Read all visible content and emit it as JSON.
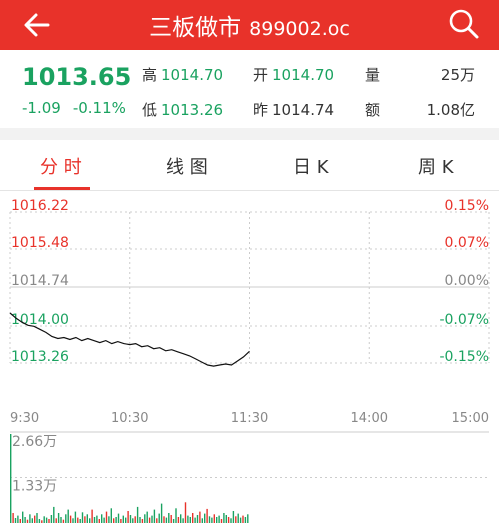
{
  "header": {
    "title": "三板做市",
    "code": "899002.oc",
    "back_icon": "arrow-left-icon",
    "search_icon": "search-icon",
    "bar_color": "#e8322a"
  },
  "quote": {
    "price": "1013.65",
    "change": "-1.09",
    "change_pct": "-0.11%",
    "high_label": "高",
    "high": "1014.70",
    "open_label": "开",
    "open": "1014.70",
    "volume_label": "量",
    "volume": "25万",
    "low_label": "低",
    "low": "1013.26",
    "prev_close_label": "昨",
    "prev_close": "1014.74",
    "amount_label": "额",
    "amount": "1.08亿"
  },
  "tabs": [
    {
      "label": "分 时",
      "active": true
    },
    {
      "label": "线 图",
      "active": false
    },
    {
      "label": "日 K",
      "active": false
    },
    {
      "label": "周 K",
      "active": false
    }
  ],
  "chart_data": {
    "type": "line",
    "price_axis_labels": [
      "1016.22",
      "1015.48",
      "1014.74",
      "1014.00",
      "1013.26"
    ],
    "pct_axis_labels": [
      "0.15%",
      "0.07%",
      "0.00%",
      "-0.07%",
      "-0.15%"
    ],
    "ylim": [
      1013.26,
      1016.22
    ],
    "prev_close": 1014.74,
    "time_labels": [
      "9:30",
      "10:30",
      "11:30",
      "14:00",
      "15:00"
    ],
    "series": [
      {
        "x": [
          "9:30",
          "9:33",
          "9:36",
          "9:39",
          "9:42",
          "9:45",
          "9:48",
          "9:51",
          "9:54",
          "9:57",
          "10:00",
          "10:03",
          "10:06",
          "10:09",
          "10:12",
          "10:15",
          "10:18",
          "10:21",
          "10:24",
          "10:27",
          "10:30",
          "10:33",
          "10:36",
          "10:39",
          "10:42",
          "10:45",
          "10:48",
          "10:51",
          "10:54",
          "10:57",
          "11:00",
          "11:03",
          "11:06",
          "11:09",
          "11:12",
          "11:15",
          "11:18",
          "11:21",
          "11:24",
          "11:27",
          "11:30"
        ],
        "values": [
          1014.24,
          1014.14,
          1014.06,
          1014.0,
          1013.98,
          1013.92,
          1013.86,
          1013.78,
          1013.74,
          1013.76,
          1013.72,
          1013.76,
          1013.7,
          1013.74,
          1013.7,
          1013.66,
          1013.7,
          1013.64,
          1013.68,
          1013.64,
          1013.62,
          1013.64,
          1013.58,
          1013.6,
          1013.54,
          1013.56,
          1013.5,
          1013.52,
          1013.48,
          1013.44,
          1013.4,
          1013.34,
          1013.28,
          1013.22,
          1013.2,
          1013.22,
          1013.24,
          1013.22,
          1013.3,
          1013.38,
          1013.49
        ]
      }
    ],
    "volume_axis_labels": [
      "2.66万",
      "1.33万"
    ],
    "volume_ylim": [
      0,
      2.66
    ],
    "volume_unit": "万",
    "volume": [
      2.66,
      0.3,
      0.15,
      0.22,
      0.12,
      0.34,
      0.18,
      0.1,
      0.26,
      0.14,
      0.22,
      0.3,
      0.12,
      0.08,
      0.2,
      0.16,
      0.12,
      0.24,
      0.48,
      0.14,
      0.3,
      0.18,
      0.1,
      0.26,
      0.4,
      0.22,
      0.14,
      0.34,
      0.16,
      0.12,
      0.32,
      0.2,
      0.26,
      0.14,
      0.4,
      0.18,
      0.22,
      0.12,
      0.26,
      0.16,
      0.34,
      0.2,
      0.44,
      0.14,
      0.18,
      0.28,
      0.12,
      0.22,
      0.16,
      0.36,
      0.24,
      0.14,
      0.2,
      0.48,
      0.18,
      0.12,
      0.26,
      0.34,
      0.16,
      0.22,
      0.4,
      0.14,
      0.28,
      0.58,
      0.2,
      0.16,
      0.3,
      0.24,
      0.12,
      0.44,
      0.18,
      0.26,
      0.14,
      0.62,
      0.22,
      0.18,
      0.3,
      0.16,
      0.24,
      0.34,
      0.14,
      0.28,
      0.42,
      0.2,
      0.16,
      0.26,
      0.18,
      0.22,
      0.12,
      0.3,
      0.24,
      0.18,
      0.14,
      0.36,
      0.2,
      0.28,
      0.16,
      0.22,
      0.18,
      0.26
    ],
    "colors": {
      "up": "#e8322a",
      "down": "#1aa260",
      "line": "#111111",
      "grid": "#cccccc",
      "neutral": "#888888"
    }
  }
}
